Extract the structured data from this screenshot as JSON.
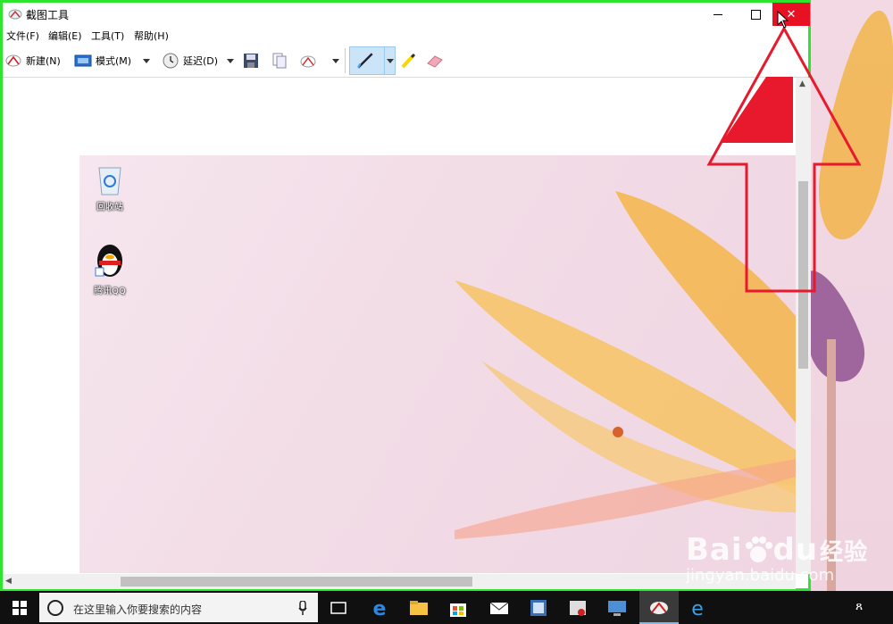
{
  "window": {
    "title": "截图工具",
    "close_symbol": "✕"
  },
  "menu": [
    "文件(F)",
    "编辑(E)",
    "工具(T)",
    "帮助(H)"
  ],
  "toolbar": {
    "new_label": "新建(N)",
    "mode_label": "模式(M)",
    "delay_label": "延迟(D)"
  },
  "desktop_icons": [
    {
      "label": "回收站",
      "icon": "recycle-bin-icon"
    },
    {
      "label": "腾讯QQ",
      "icon": "qq-penguin-icon"
    }
  ],
  "taskbar": {
    "search_placeholder": "在这里输入你要搜索的内容",
    "tray_people": "ጸ"
  },
  "watermark": {
    "brand": "Bai",
    "brand2": "du",
    "brand3": "经验",
    "url": "jingyan.baidu.com"
  },
  "colors": {
    "highlight_border": "#2ee52e",
    "close_red": "#e81123",
    "arrow_red": "#e8192c"
  }
}
